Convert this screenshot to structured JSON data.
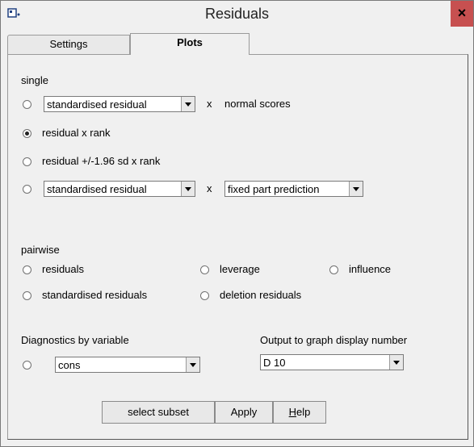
{
  "window": {
    "title": "Residuals",
    "close_label": "×"
  },
  "tabs": [
    {
      "label": "Settings",
      "active": false
    },
    {
      "label": "Plots",
      "active": true
    }
  ],
  "single": {
    "heading": "single",
    "row1": {
      "combo": "standardised residual",
      "times": "x",
      "suffix": "normal scores",
      "checked": false
    },
    "row2": {
      "label": "residual x rank",
      "checked": true
    },
    "row3": {
      "label": "residual +/-1.96 sd x  rank",
      "checked": false
    },
    "row4": {
      "combo_left": "standardised residual",
      "times": "x",
      "combo_right": "fixed part prediction",
      "checked": false
    }
  },
  "pairwise": {
    "heading": "pairwise",
    "options": [
      {
        "label": "residuals",
        "checked": false
      },
      {
        "label": "leverage",
        "checked": false
      },
      {
        "label": "influence",
        "checked": false
      },
      {
        "label": "standardised residuals",
        "checked": false
      },
      {
        "label": "deletion residuals",
        "checked": false
      }
    ]
  },
  "diagnostics": {
    "heading": "Diagnostics by variable",
    "combo": "cons",
    "checked": false
  },
  "output": {
    "heading": "Output to graph display number",
    "combo": "D 10"
  },
  "buttons": {
    "select_subset": "select subset",
    "apply": "Apply",
    "help": "Help"
  }
}
